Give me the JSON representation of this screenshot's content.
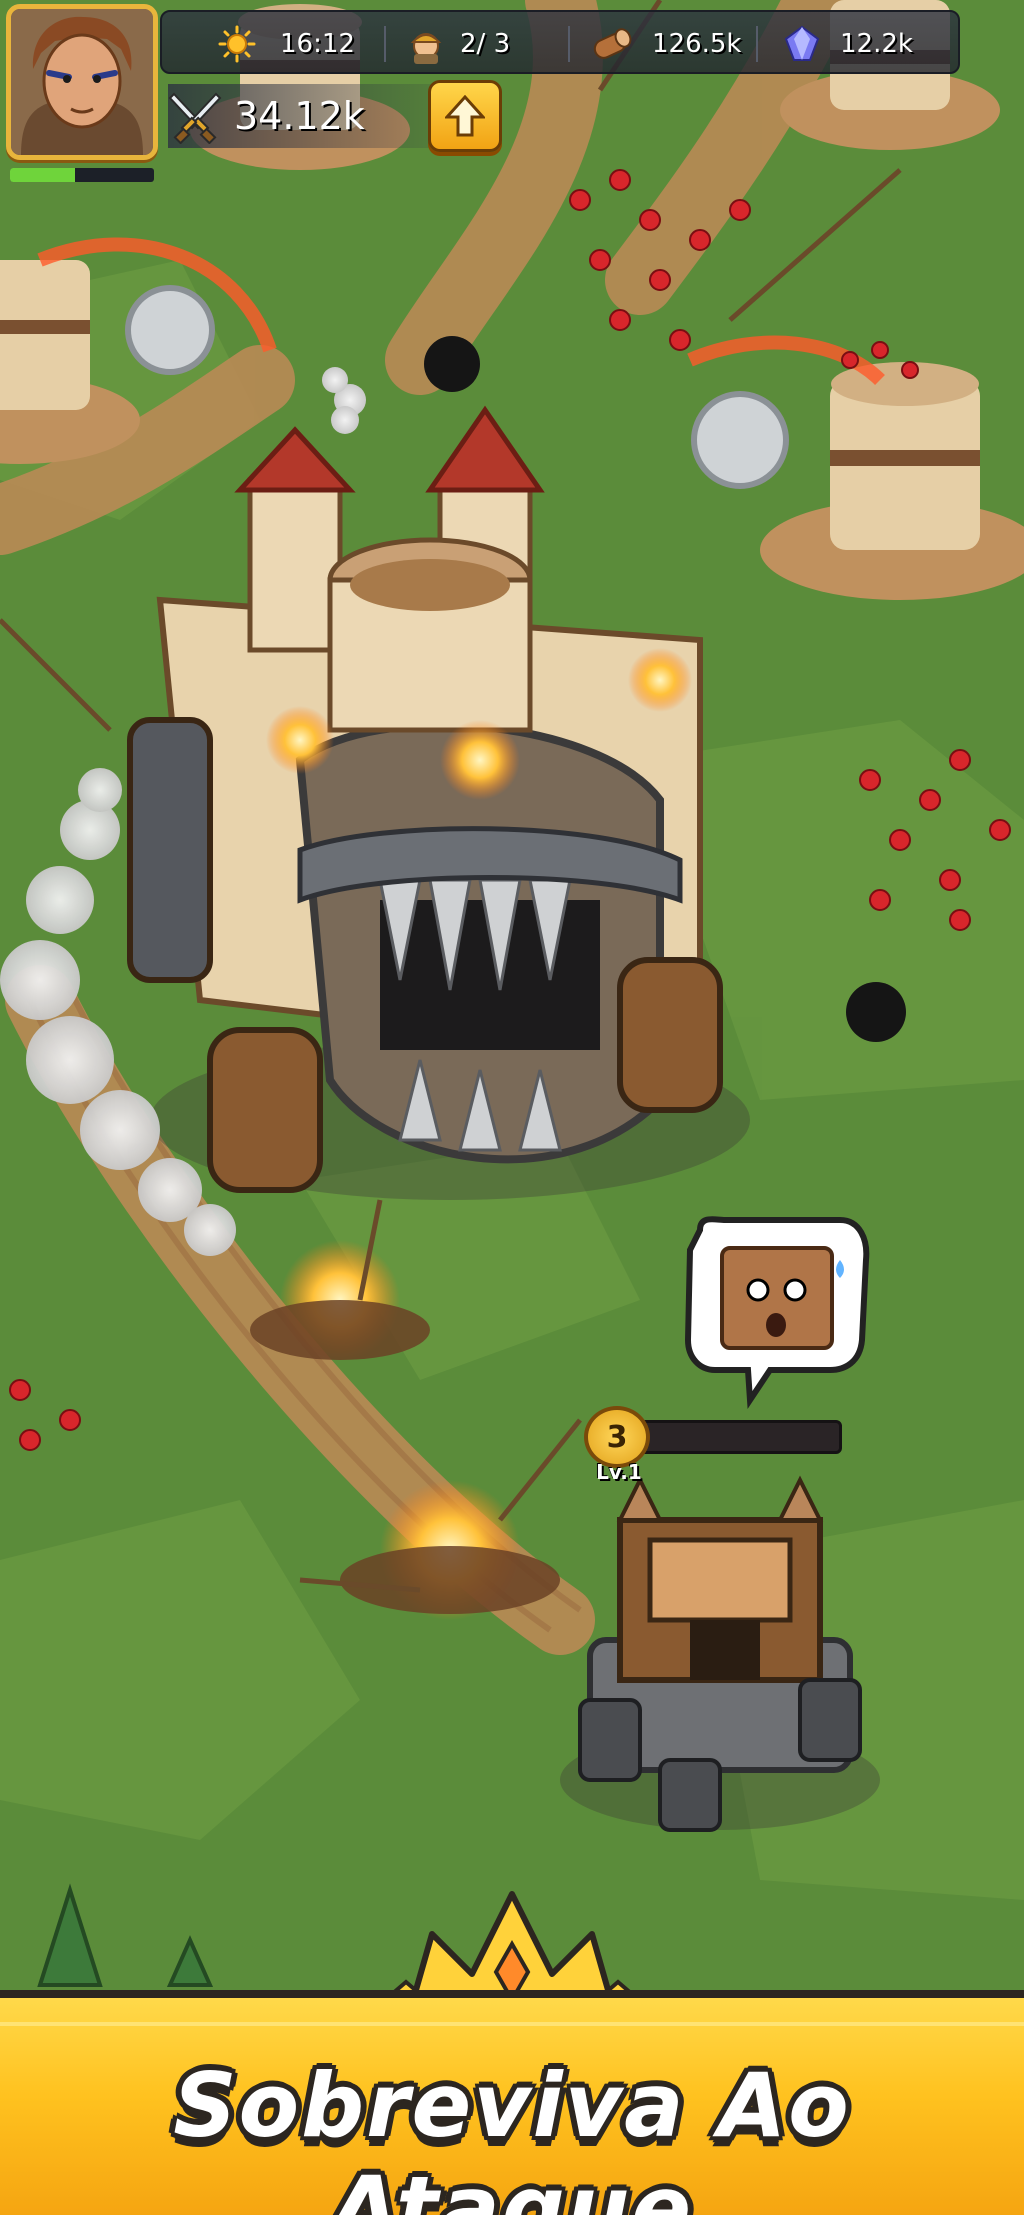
{
  "hud": {
    "time": "16:12",
    "workers": "2/ 3",
    "wood": "126.5k",
    "gems": "12.2k",
    "power": "34.12k",
    "xp_progress": 0.45,
    "icons": {
      "time": "sun-icon",
      "workers": "worker-icon",
      "wood": "wood-log-icon",
      "gems": "gem-icon",
      "power": "crossed-swords-icon",
      "upgrade": "arrow-up-icon"
    }
  },
  "player_unit": {
    "level_number": "3",
    "level_label": "Lv.1",
    "health_fraction": 0.08
  },
  "banner": {
    "title": "Sobreviva Ao Ataque"
  },
  "colors": {
    "grass": "#5a8a3a",
    "path": "#b98a55",
    "banner": "#ffc21f",
    "accent_gold": "#e8b53c",
    "enemy_red": "#d8262b",
    "health_red": "#e02b2b",
    "xp_green": "#6fd43b"
  }
}
